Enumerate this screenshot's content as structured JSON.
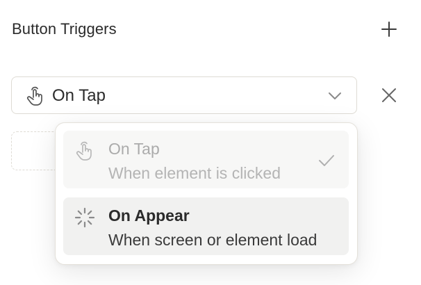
{
  "section": {
    "title": "Button Triggers"
  },
  "trigger": {
    "selected_label": "On Tap",
    "selected_icon": "hand-tap-icon"
  },
  "dropdown": {
    "items": [
      {
        "title": "On Tap",
        "description": "When element is clicked",
        "icon": "hand-tap-icon",
        "selected": true
      },
      {
        "title": "On Appear",
        "description": "When screen or element load",
        "icon": "loading-spinner-icon",
        "selected": false
      }
    ]
  },
  "colors": {
    "text_primary": "#2b2b2b",
    "text_disabled": "#ababab",
    "border": "#dedbd4",
    "hover_background": "#f1f1f0",
    "icon_gray": "#8a8a8a"
  }
}
